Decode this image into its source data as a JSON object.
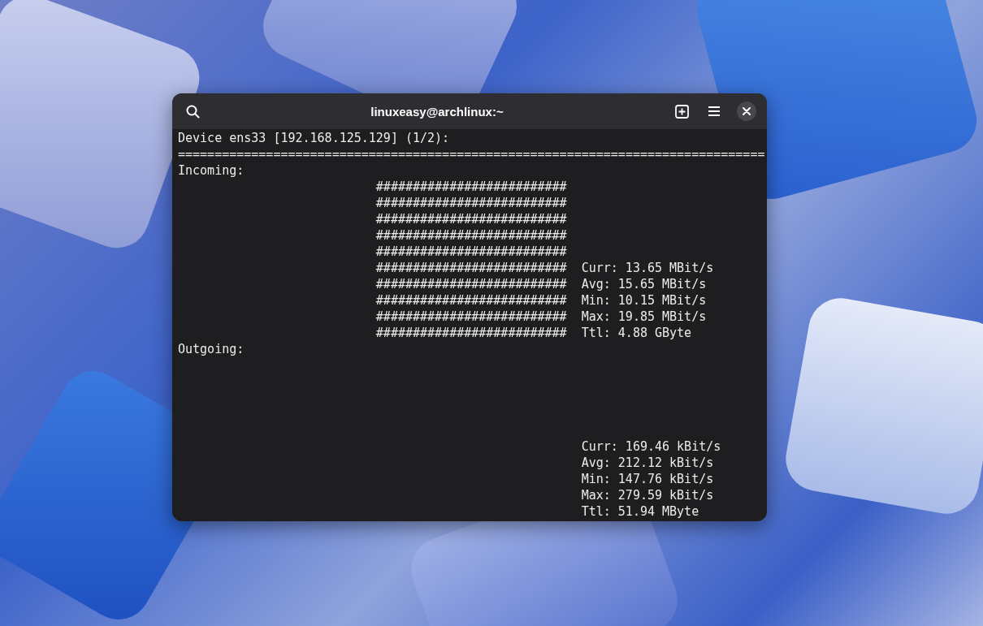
{
  "window": {
    "title": "linuxeasy@archlinux:~"
  },
  "terminal": {
    "header": "Device ens33 [192.168.125.129] (1/2):",
    "separator": "================================================================================",
    "sections": [
      {
        "label": "Incoming:",
        "graph_rows": [
          "##########################",
          "##########################",
          "##########################",
          "##########################",
          "##########################",
          "##########################",
          "##########################",
          "##########################",
          "##########################",
          "##########################"
        ],
        "stats": [
          "Curr: 13.65 MBit/s",
          "Avg: 15.65 MBit/s",
          "Min: 10.15 MBit/s",
          "Max: 19.85 MBit/s",
          "Ttl: 4.88 GByte"
        ]
      },
      {
        "label": "Outgoing:",
        "stats": [
          "Curr: 169.46 kBit/s",
          "Avg: 212.12 kBit/s",
          "Min: 147.76 kBit/s",
          "Max: 279.59 kBit/s",
          "Ttl: 51.94 MByte"
        ]
      }
    ]
  }
}
